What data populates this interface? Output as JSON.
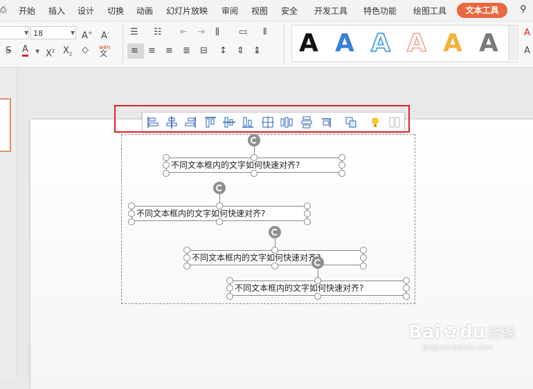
{
  "menubar": {
    "items": [
      "开始",
      "插入",
      "设计",
      "切换",
      "动画",
      "幻灯片放映",
      "审阅",
      "视图",
      "安全",
      "开发工具",
      "特色功能",
      "绘图工具"
    ],
    "active": "文本工具"
  },
  "ribbon": {
    "font_size": "18",
    "phonetic_label": "wén"
  },
  "style_gallery": {
    "letters": [
      "A",
      "A",
      "A",
      "A",
      "A",
      "A"
    ],
    "colors": [
      "#111111",
      "#3a7fd6",
      "#5aa6e6",
      "#f2a08e",
      "#f4b23b",
      "#7a7a7a"
    ]
  },
  "textboxes": [
    {
      "text": "不同文本框内的文字如何快速对齐?"
    },
    {
      "text": "不同文本框内的文字如何快速对齐?"
    },
    {
      "text": "不同文本框内的文字如何快速对齐?"
    },
    {
      "text": "不同文本框内的文字如何快速对齐?"
    }
  ],
  "float_toolbar": {
    "buttons": [
      "align-left-icon",
      "align-center-icon",
      "align-right-icon",
      "align-top-icon",
      "align-middle-icon",
      "align-bottom-icon",
      "distribute-icon",
      "distribute-horizontal-icon",
      "distribute-vertical-icon",
      "fit-icon",
      "group-icon",
      "smart-tip-icon",
      "more-icon"
    ]
  },
  "watermark": {
    "brand_a": "Bai",
    "brand_b": "du",
    "brand_c": "经验",
    "url": "jingyan.baidu.com"
  },
  "colors": {
    "active_tab": "#e8693e",
    "highlight": "#e02020"
  }
}
